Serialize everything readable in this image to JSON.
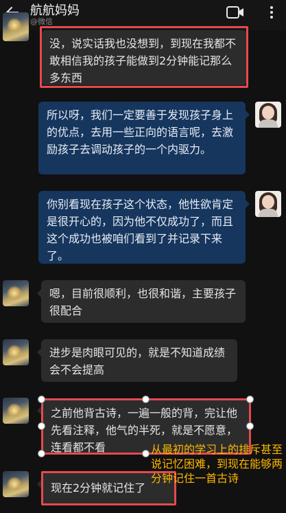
{
  "header": {
    "title": "航航妈妈",
    "subtitle": "@微信",
    "back_icon": "back-arrow-icon",
    "video_icon": "video-call-icon",
    "more_icon": "more-icon"
  },
  "messages": [
    {
      "side": "in",
      "text": "没，说实话我也没想到，到现在我都不敢相信我的孩子能做到2分钟能记那么多东西"
    },
    {
      "side": "out",
      "text": "所以呀，我们一定要善于发现孩子身上的优点，去用一些正向的语言呢，去激励孩子去调动孩子的一个内驱力。"
    },
    {
      "side": "out",
      "text": "你别看现在孩子这个状态，他性欲肯定是很开心的，因为他不仅成功了，而且这个成功也被咱们看到了并记录下来了。"
    },
    {
      "side": "in",
      "text": "嗯，目前很顺利，也很和谐，主要孩子很配合"
    },
    {
      "side": "in",
      "text": "进步是肉眼可见的，就是不知道成绩会不会提高"
    },
    {
      "side": "in",
      "text": "之前他背古诗，一遍一般的背，完让他先看注释，他气的半死，就是不愿意，连看都不看"
    },
    {
      "side": "in",
      "text": "现在2分钟就记住了"
    }
  ],
  "annotation": "从最初的学习上的排斥甚至说记忆困难，到现在能够两分钟记住一首古诗",
  "colors": {
    "background": "#111111",
    "incoming_bubble": "#2c2c2c",
    "outgoing_bubble": "#16365e",
    "highlight": "#e54a4f",
    "annotation": "#ffb800"
  }
}
